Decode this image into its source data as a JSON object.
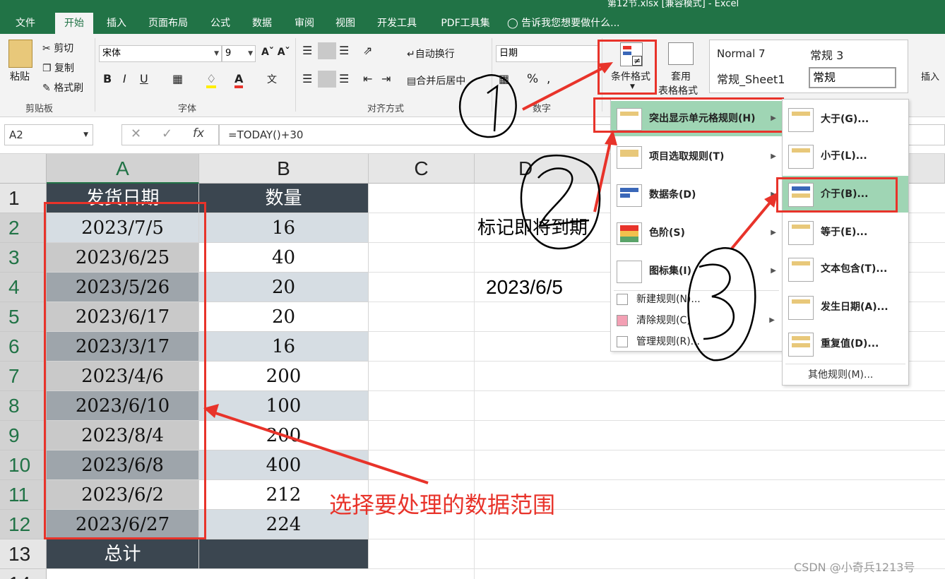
{
  "title_fragment": "第12节.xlsx  [兼容模式]  -  Excel",
  "tabs": [
    "文件",
    "开始",
    "插入",
    "页面布局",
    "公式",
    "数据",
    "审阅",
    "视图",
    "开发工具",
    "PDF工具集"
  ],
  "tell_me": "告诉我您想要做什么...",
  "clipboard": {
    "paste": "粘贴",
    "cut": "剪切",
    "copy": "复制",
    "painter": "格式刷",
    "group": "剪贴板"
  },
  "font": {
    "name": "宋体",
    "size": "9",
    "group": "字体"
  },
  "align": {
    "wrap": "自动换行",
    "merge": "合并后居中",
    "group": "对齐方式"
  },
  "number": {
    "format": "日期",
    "group": "数字"
  },
  "styles": {
    "cond": "条件格式",
    "table_line1": "套用",
    "table_line2": "表格格式",
    "s1": "Normal 7",
    "s2": "常规  3",
    "s3": "常规_Sheet1",
    "s4": "常规",
    "insert": "插入"
  },
  "formula_bar": {
    "name": "A2",
    "formula": "=TODAY()+30"
  },
  "columns": [
    "A",
    "B",
    "C",
    "D"
  ],
  "rows": [
    "1",
    "2",
    "3",
    "4",
    "5",
    "6",
    "7",
    "8",
    "9",
    "10",
    "11",
    "12",
    "13",
    "14"
  ],
  "table": {
    "header": [
      "发货日期",
      "数量"
    ],
    "data": [
      [
        "2023/7/5",
        "16"
      ],
      [
        "2023/6/25",
        "40"
      ],
      [
        "2023/5/26",
        "20"
      ],
      [
        "2023/6/17",
        "20"
      ],
      [
        "2023/3/17",
        "16"
      ],
      [
        "2023/4/6",
        "200"
      ],
      [
        "2023/6/10",
        "100"
      ],
      [
        "2023/8/4",
        "200"
      ],
      [
        "2023/6/8",
        "400"
      ],
      [
        "2023/6/2",
        "212"
      ],
      [
        "2023/6/27",
        "224"
      ]
    ],
    "total": "总计"
  },
  "d_label": "标记即将到期",
  "d_date": "2023/6/5",
  "cf_menu": {
    "items": [
      "突出显示单元格规则(H)",
      "项目选取规则(T)",
      "数据条(D)",
      "色阶(S)",
      "图标集(I)"
    ],
    "small": [
      "新建规则(N)...",
      "清除规则(C)",
      "管理规则(R)..."
    ]
  },
  "sub_menu": {
    "items": [
      "大于(G)...",
      "小于(L)...",
      "介于(B)...",
      "等于(E)...",
      "文本包含(T)...",
      "发生日期(A)...",
      "重复值(D)..."
    ],
    "more": "其他规则(M)..."
  },
  "annotation": "选择要处理的数据范围",
  "watermark": "CSDN @小奇兵1213号",
  "colors": {
    "excel_green": "#217346",
    "accent_red": "#e8332a",
    "highlight_green": "#9fd5b4",
    "header_dark": "#3b4650"
  }
}
